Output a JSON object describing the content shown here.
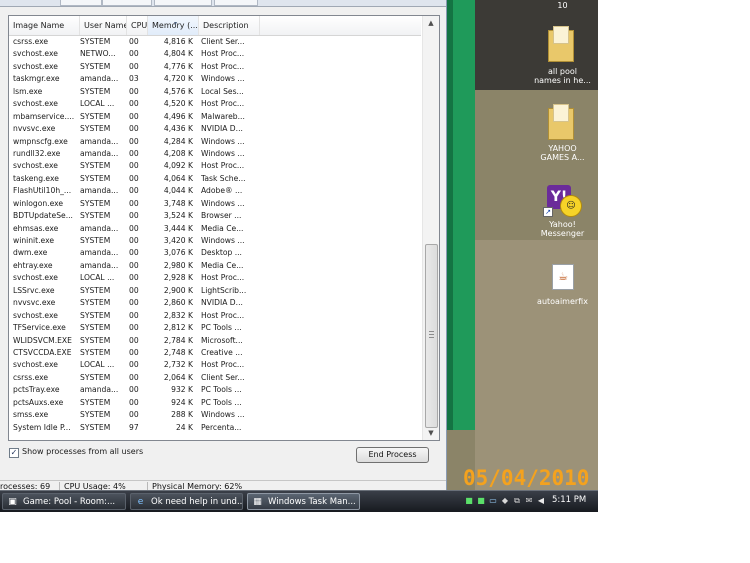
{
  "task_manager": {
    "columns": [
      "Image Name",
      "User Name",
      "CPU",
      "Memory (...",
      "Description"
    ],
    "processes": [
      [
        "csrss.exe",
        "SYSTEM",
        "00",
        "4,816 K",
        "Client Ser..."
      ],
      [
        "svchost.exe",
        "NETWO...",
        "00",
        "4,804 K",
        "Host Proc..."
      ],
      [
        "svchost.exe",
        "SYSTEM",
        "00",
        "4,776 K",
        "Host Proc..."
      ],
      [
        "taskmgr.exe",
        "amanda...",
        "03",
        "4,720 K",
        "Windows ..."
      ],
      [
        "lsm.exe",
        "SYSTEM",
        "00",
        "4,576 K",
        "Local Ses..."
      ],
      [
        "svchost.exe",
        "LOCAL ...",
        "00",
        "4,520 K",
        "Host Proc..."
      ],
      [
        "mbamservice....",
        "SYSTEM",
        "00",
        "4,496 K",
        "Malwareb..."
      ],
      [
        "nvvsvc.exe",
        "SYSTEM",
        "00",
        "4,436 K",
        "NVIDIA D..."
      ],
      [
        "wmpnscfg.exe",
        "amanda...",
        "00",
        "4,284 K",
        "Windows ..."
      ],
      [
        "rundll32.exe",
        "amanda...",
        "00",
        "4,208 K",
        "Windows ..."
      ],
      [
        "svchost.exe",
        "SYSTEM",
        "00",
        "4,092 K",
        "Host Proc..."
      ],
      [
        "taskeng.exe",
        "SYSTEM",
        "00",
        "4,064 K",
        "Task Sche..."
      ],
      [
        "FlashUtil10h_...",
        "amanda...",
        "00",
        "4,044 K",
        "Adobe® ..."
      ],
      [
        "winlogon.exe",
        "SYSTEM",
        "00",
        "3,748 K",
        "Windows ..."
      ],
      [
        "BDTUpdateSe...",
        "SYSTEM",
        "00",
        "3,524 K",
        "Browser ..."
      ],
      [
        "ehmsas.exe",
        "amanda...",
        "00",
        "3,444 K",
        "Media Ce..."
      ],
      [
        "wininit.exe",
        "SYSTEM",
        "00",
        "3,420 K",
        "Windows ..."
      ],
      [
        "dwm.exe",
        "amanda...",
        "00",
        "3,076 K",
        "Desktop ..."
      ],
      [
        "ehtray.exe",
        "amanda...",
        "00",
        "2,980 K",
        "Media Ce..."
      ],
      [
        "svchost.exe",
        "LOCAL ...",
        "00",
        "2,928 K",
        "Host Proc..."
      ],
      [
        "LSSrvc.exe",
        "SYSTEM",
        "00",
        "2,900 K",
        "LightScrib..."
      ],
      [
        "nvvsvc.exe",
        "SYSTEM",
        "00",
        "2,860 K",
        "NVIDIA D..."
      ],
      [
        "svchost.exe",
        "SYSTEM",
        "00",
        "2,832 K",
        "Host Proc..."
      ],
      [
        "TFService.exe",
        "SYSTEM",
        "00",
        "2,812 K",
        "PC Tools ..."
      ],
      [
        "WLIDSVCM.EXE",
        "SYSTEM",
        "00",
        "2,784 K",
        "Microsoft..."
      ],
      [
        "CTSVCCDA.EXE",
        "SYSTEM",
        "00",
        "2,748 K",
        "Creative ..."
      ],
      [
        "svchost.exe",
        "LOCAL ...",
        "00",
        "2,732 K",
        "Host Proc..."
      ],
      [
        "csrss.exe",
        "SYSTEM",
        "00",
        "2,064 K",
        "Client Ser..."
      ],
      [
        "pctsTray.exe",
        "amanda...",
        "00",
        "932 K",
        "PC Tools ..."
      ],
      [
        "pctsAuxs.exe",
        "SYSTEM",
        "00",
        "924 K",
        "PC Tools ..."
      ],
      [
        "smss.exe",
        "SYSTEM",
        "00",
        "288 K",
        "Windows ..."
      ],
      [
        "System Idle P...",
        "SYSTEM",
        "97",
        "24 K",
        "Percenta..."
      ]
    ],
    "show_all_label": "Show processes from all users",
    "show_all_checked": true,
    "end_process_label": "End Process",
    "status_processes": "rocesses: 69",
    "status_cpu": "CPU Usage: 4%",
    "status_memory": "Physical Memory: 62%"
  },
  "desktop": {
    "top_label": "10",
    "icons": [
      {
        "label_line1": "all pool",
        "label_line2": "names in he...",
        "icon": "folder-icon"
      },
      {
        "label_line1": "YAHOO",
        "label_line2": "GAMES A...",
        "icon": "folder-icon"
      },
      {
        "label_line1": "Yahoo!",
        "label_line2": "Messenger",
        "icon": "yahoo-messenger-icon"
      },
      {
        "label_line1": "autoaimerfix",
        "label_line2": "",
        "icon": "java-file-icon"
      }
    ],
    "date_stamp": "05/04/2010"
  },
  "taskbar": {
    "buttons": [
      {
        "label": "Game: Pool - Room:...",
        "icon": "game-window-icon",
        "active": false
      },
      {
        "label": "Ok need help in und...",
        "icon": "internet-explorer-icon",
        "active": false
      },
      {
        "label": "Windows Task Man...",
        "icon": "task-manager-icon",
        "active": true
      }
    ],
    "clock": "5:11 PM"
  }
}
